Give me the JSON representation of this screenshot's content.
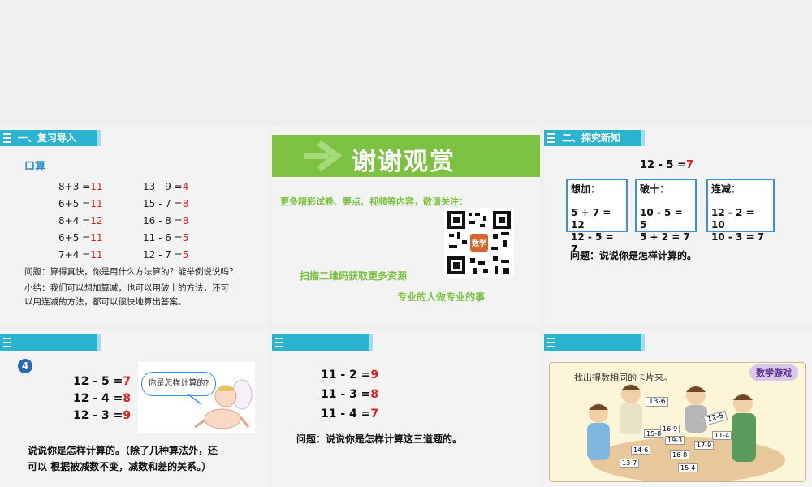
{
  "slide1": {
    "header": "一、复习导入",
    "kousuan": "口算",
    "left_col": [
      {
        "expr": "8+3 =",
        "ans": "11"
      },
      {
        "expr": "6+5 =",
        "ans": "11"
      },
      {
        "expr": "8+4 =",
        "ans": "12"
      },
      {
        "expr": "6+5 =",
        "ans": "11"
      },
      {
        "expr": "7+4 =",
        "ans": "11"
      }
    ],
    "right_col": [
      {
        "expr": "13 - 9 =",
        "ans": "4"
      },
      {
        "expr": "15 - 7 =",
        "ans": "8"
      },
      {
        "expr": "16 - 8 =",
        "ans": "8"
      },
      {
        "expr": "11 - 6 =",
        "ans": "5"
      },
      {
        "expr": "12 - 7 =",
        "ans": "5"
      }
    ],
    "question": "问题：算得真快，你是用什么方法算的？能举例说说吗？",
    "summary_line1": "小结：我们可以想加算减，也可以用破十的方法，还可",
    "summary_line2": "以用连减的方法，都可以很快地算出答案。"
  },
  "slide2": {
    "banner": "谢谢观赏",
    "line1": "更多精彩试卷、要点、视频等内容，敬请关注：",
    "line2": "扫描二维码获取更多资源",
    "line3": "专业的人做专业的事",
    "qr_badge": "数学"
  },
  "slide3": {
    "header": "二、探究新知",
    "problem": "12 - 5 =",
    "problem_ans": "7",
    "box1": {
      "title": "想加：",
      "l1": "5 + 7 = 12",
      "l2": "12 - 5 = 7"
    },
    "box2": {
      "title": "破十：",
      "l1": "10 - 5 = 5",
      "l2": "5 + 2 = 7"
    },
    "box3": {
      "title": "连减：",
      "l1": "12 - 2 = 10",
      "l2": "10 - 3 = 7"
    },
    "question": "问题：说说你是怎样计算的。"
  },
  "slide4": {
    "num": "4",
    "rows": [
      {
        "expr": "12 - 5 =",
        "ans": "7"
      },
      {
        "expr": "12 - 4 =",
        "ans": "8"
      },
      {
        "expr": "12 - 3 =",
        "ans": "9"
      }
    ],
    "bubble": "你是怎样计算的?",
    "text1": "说说你是怎样计算的。（除了几种算法外，还",
    "text2": "可以 根据被减数不变，减数和差的关系。）"
  },
  "slide5": {
    "rows": [
      {
        "expr": "11 - 2 =",
        "ans": "9"
      },
      {
        "expr": "11 - 3 =",
        "ans": "8"
      },
      {
        "expr": "11 - 4 =",
        "ans": "7"
      }
    ],
    "question": "问题：说说你是怎样计算这三道题的。"
  },
  "slide6": {
    "instruction": "找出得数相同的卡片来。",
    "tag": "数学游戏",
    "cards": [
      "13-6",
      "12-5",
      "15-8",
      "14-6",
      "16-8",
      "19-3",
      "13-7",
      "15-4",
      "17-9",
      "16-9",
      "11-4"
    ]
  },
  "colors": {
    "accent": "#2bb3cf",
    "green": "#7dc142",
    "red": "#e02020",
    "box_border": "#3d8fe0"
  }
}
